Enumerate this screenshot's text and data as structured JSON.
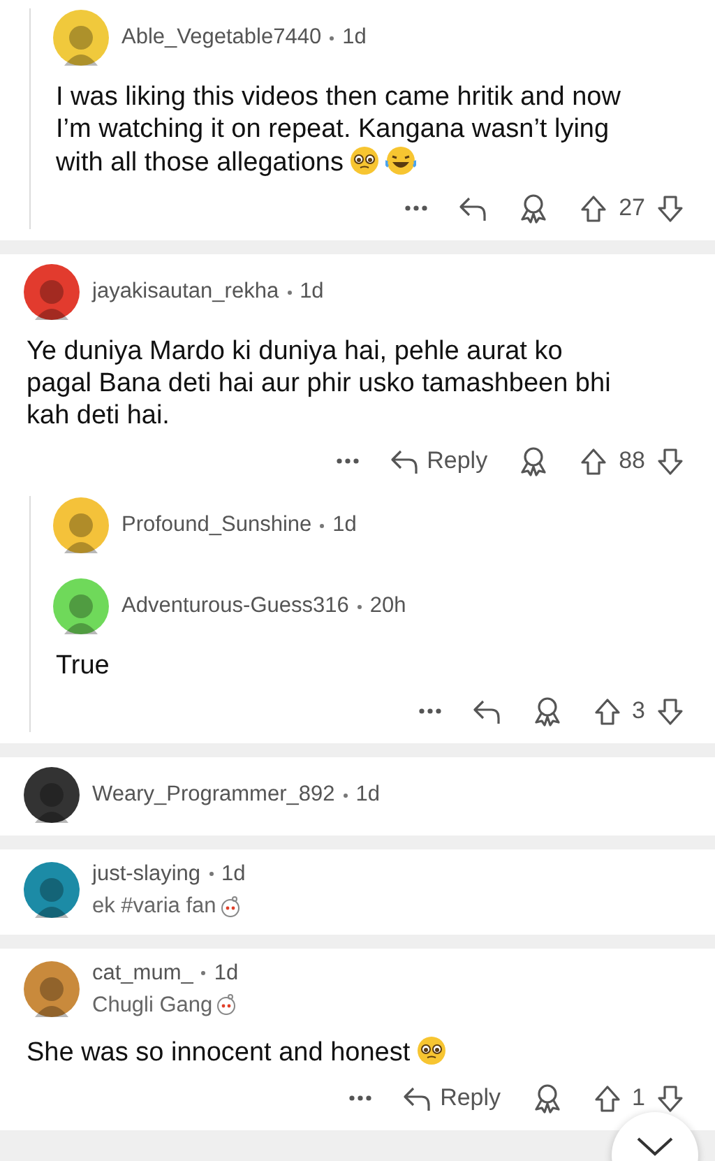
{
  "threads": [
    {
      "replies": [
        {
          "username": "Able_Vegetable7440",
          "age": "1d",
          "color": "#f0c93c",
          "body": "I was liking this videos then came hritik and now I’m watching it on repeat. Kangana wasn’t lying with all those allegations",
          "emoji": [
            {
              "kind": "pleading"
            },
            {
              "kind": "laughing"
            }
          ],
          "actions": {
            "score": "27"
          }
        }
      ]
    },
    {
      "comment": {
        "username": "jayakisautan_rekha",
        "age": "1d",
        "color": "#e23b2e",
        "body": "Ye duniya Mardo ki duniya hai, pehle aurat ko pagal Bana deti hai aur phir usko tamashbeen bhi kah deti hai.",
        "actions": {
          "reply_label": "Reply",
          "score": "88"
        }
      },
      "replies": [
        {
          "username": "Profound_Sunshine",
          "age": "1d",
          "color": "#f4c23a"
        },
        {
          "username": "Adventurous-Guess316",
          "age": "20h",
          "color": "#6fd95a",
          "body": "True",
          "actions": {
            "score": "3"
          }
        }
      ]
    },
    {
      "comment": {
        "username": "Weary_Programmer_892",
        "age": "1d",
        "color": "#333333"
      }
    },
    {
      "comment": {
        "username": "just-slaying",
        "age": "1d",
        "color": "#1c8ba6",
        "flair": "ek #varia fan"
      }
    },
    {
      "comment": {
        "username": "cat_mum_",
        "age": "1d",
        "color": "#c98a3c",
        "flair": "Chugli Gang",
        "body": "She was so innocent and honest",
        "emoji": [
          {
            "kind": "pleading"
          }
        ],
        "actions": {
          "reply_label": "Reply",
          "score": "1"
        }
      }
    }
  ]
}
